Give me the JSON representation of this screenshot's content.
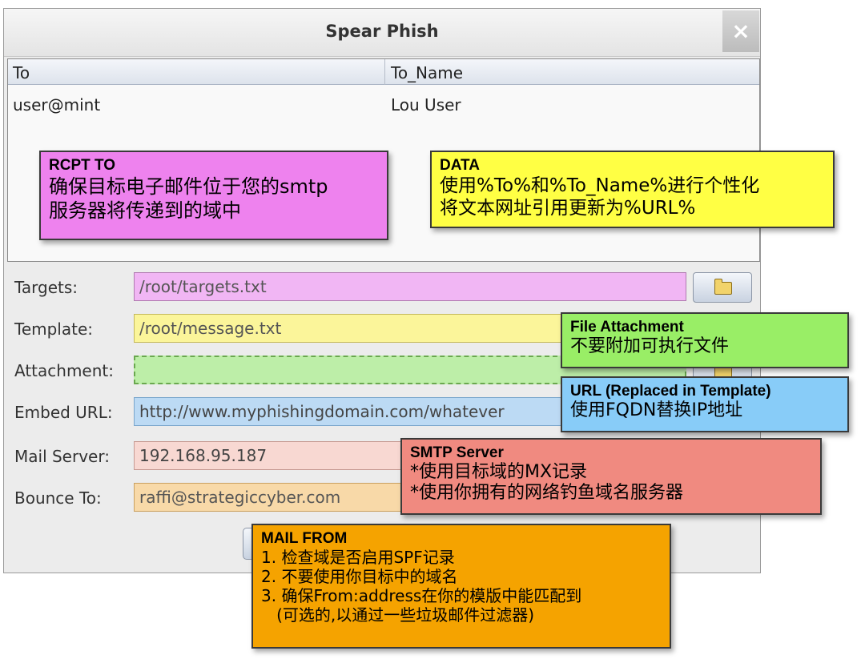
{
  "dialog": {
    "title": "Spear Phish",
    "close_label": "×"
  },
  "table": {
    "columns": [
      "To",
      "To_Name"
    ],
    "rows": [
      [
        "user@mint",
        "Lou User"
      ]
    ]
  },
  "form": {
    "targets": {
      "label": "Targets:",
      "value": "/root/targets.txt"
    },
    "template": {
      "label": "Template:",
      "value": "/root/message.txt"
    },
    "attachment": {
      "label": "Attachment:",
      "value": ""
    },
    "embed_url": {
      "label": "Embed URL:",
      "value": "http://www.myphishingdomain.com/whatever"
    },
    "mail_server": {
      "label": "Mail Server:",
      "value": "192.168.95.187"
    },
    "bounce_to": {
      "label": "Bounce To:",
      "value": "raffi@strategiccyber.com"
    }
  },
  "callouts": {
    "rcpt_to": {
      "title": "RCPT TO",
      "lines": [
        "确保目标电子邮件位于您的smtp",
        "服务器将传递到的域中"
      ],
      "color": "#ee82ee"
    },
    "data": {
      "title": "DATA",
      "lines": [
        "使用%To%和%To_Name%进行个性化",
        "将文本网址引用更新为%URL%"
      ],
      "color": "#ffff44"
    },
    "file_attachment": {
      "title": "File Attachment",
      "lines": [
        "不要附加可执行文件"
      ],
      "color": "#99ee66"
    },
    "url": {
      "title": "URL (Replaced in Template)",
      "lines": [
        "使用FQDN替换IP地址"
      ],
      "color": "#88ccf8"
    },
    "smtp_server": {
      "title": "SMTP Server",
      "lines": [
        "*使用目标域的MX记录",
        "*使用你拥有的网络钓鱼域名服务器"
      ],
      "color": "#f08a80"
    },
    "mail_from": {
      "title": "MAIL FROM",
      "lines": [
        "1. 检查域是否启用SPF记录",
        "2. 不要使用你目标中的域名",
        "3. 确保From:address在你的模版中能匹配到",
        "   (可选的,以通过一些垃圾邮件过滤器)"
      ],
      "color": "#f5a300"
    }
  }
}
